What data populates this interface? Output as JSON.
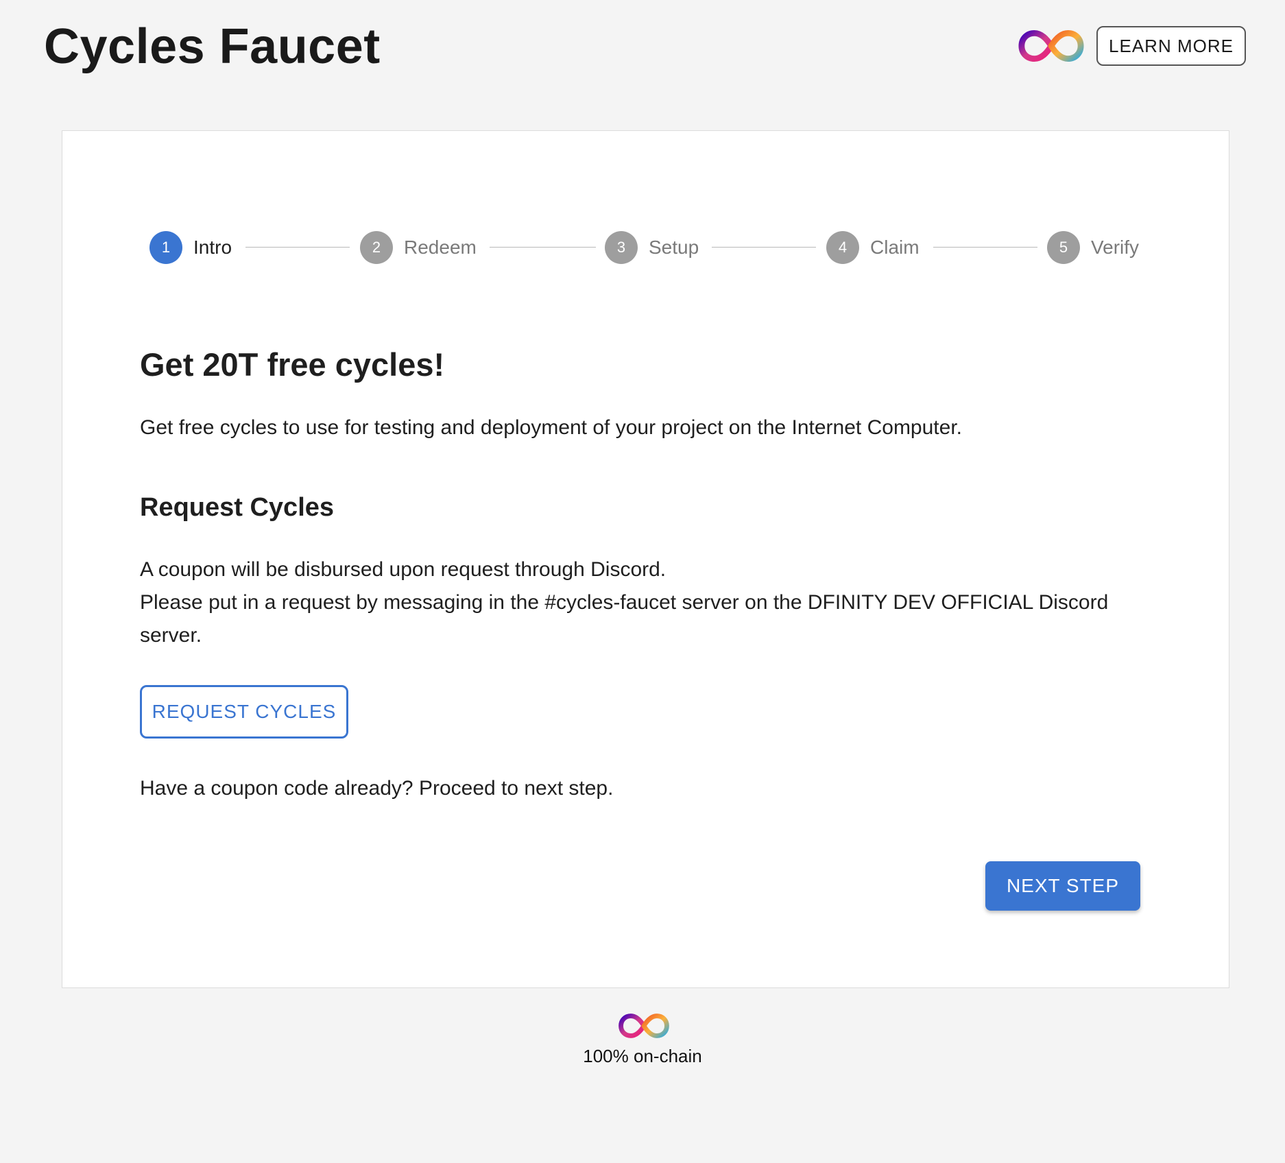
{
  "header": {
    "title": "Cycles Faucet",
    "learn_more_label": "LEARN MORE",
    "logo_icon": "infinity-logo-icon"
  },
  "stepper": {
    "steps": [
      {
        "number": "1",
        "label": "Intro",
        "active": true
      },
      {
        "number": "2",
        "label": "Redeem",
        "active": false
      },
      {
        "number": "3",
        "label": "Setup",
        "active": false
      },
      {
        "number": "4",
        "label": "Claim",
        "active": false
      },
      {
        "number": "5",
        "label": "Verify",
        "active": false
      }
    ]
  },
  "main": {
    "heading": "Get 20T free cycles!",
    "intro_text": "Get free cycles to use for testing and deployment of your project on the Internet Computer.",
    "request_heading": "Request Cycles",
    "request_line1": "A coupon will be disbursed upon request through Discord.",
    "request_line2": "Please put in a request by messaging in the #cycles-faucet server on the DFINITY DEV OFFICIAL Discord server.",
    "request_button_label": "REQUEST CYCLES",
    "coupon_text": "Have a coupon code already? Proceed to next step.",
    "next_button_label": "NEXT STEP"
  },
  "footer": {
    "text": "100% on-chain",
    "logo_icon": "infinity-logo-icon"
  },
  "colors": {
    "accent": "#3a75d1",
    "inactive_step": "#9e9e9e",
    "background": "#f4f4f4"
  }
}
